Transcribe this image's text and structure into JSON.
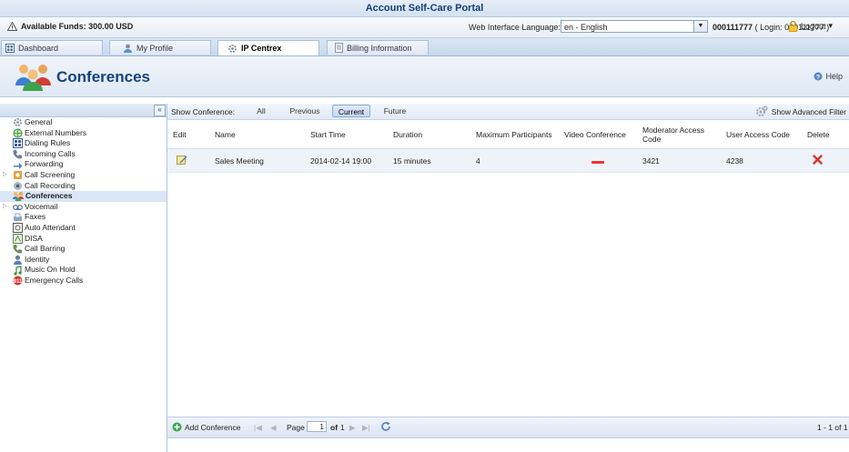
{
  "title": "Account Self-Care Portal",
  "infobar": {
    "funds": "Available Funds: 300.00 USD",
    "lang_label": "Web Interface Language:",
    "lang_value": "en - English",
    "account_id": "000111777",
    "account_login": "( Login: 000111777 )",
    "logout": "Logout",
    "logout_arrow": "▾"
  },
  "tabs": [
    {
      "label": "Dashboard"
    },
    {
      "label": "My Profile"
    },
    {
      "label": "IP Centrex"
    },
    {
      "label": "Billing Information"
    }
  ],
  "header": {
    "title": "Conferences",
    "help": "Help"
  },
  "sidebar": {
    "collapse": "«",
    "items": [
      {
        "label": "General",
        "icon": "gear-icon"
      },
      {
        "label": "External Numbers",
        "icon": "globe-icon"
      },
      {
        "label": "Dialing Rules",
        "icon": "grid-icon"
      },
      {
        "label": "Incoming Calls",
        "icon": "phone-icon"
      },
      {
        "label": "Forwarding",
        "icon": "forward-icon"
      },
      {
        "label": "Call Screening",
        "icon": "screening-icon"
      },
      {
        "label": "Call Recording",
        "icon": "record-icon"
      },
      {
        "label": "Conferences",
        "icon": "conference-icon"
      },
      {
        "label": "Voicemail",
        "icon": "voicemail-icon"
      },
      {
        "label": "Faxes",
        "icon": "fax-icon"
      },
      {
        "label": "Auto Attendant",
        "icon": "attendant-icon"
      },
      {
        "label": "DISA",
        "icon": "disa-icon"
      },
      {
        "label": "Call Barring",
        "icon": "barring-icon"
      },
      {
        "label": "Identity",
        "icon": "identity-icon"
      },
      {
        "label": "Music On Hold",
        "icon": "music-icon"
      },
      {
        "label": "Emergency Calls",
        "icon": "emergency-icon"
      }
    ]
  },
  "filter": {
    "label": "Show Conference:",
    "options": [
      "All",
      "Previous",
      "Current",
      "Future"
    ],
    "selected": "Current",
    "advanced": "Show Advanced Filter"
  },
  "table": {
    "headers": [
      "Edit",
      "Name",
      "Start Time",
      "Duration",
      "Maximum Participants",
      "Video Conference",
      "Moderator Access Code",
      "User Access Code",
      "Delete"
    ],
    "rows": [
      {
        "name": "Sales Meeting",
        "start": "2014-02-14 19:00",
        "duration": "15 minutes",
        "max": "4",
        "mod_code": "3421",
        "user_code": "4238"
      }
    ]
  },
  "pager": {
    "add": "Add Conference",
    "page_label": "Page",
    "page_value": "1",
    "of": "of",
    "total": "1",
    "range": "1 - 1 of 1"
  }
}
